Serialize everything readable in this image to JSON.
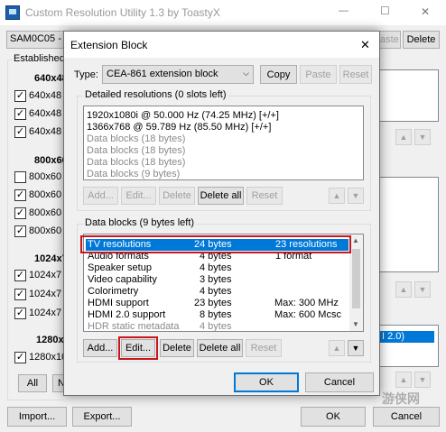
{
  "main_window": {
    "title": "Custom Resolution Utility 1.3 by ToastyX",
    "minimize_glyph": "—",
    "maximize_glyph": "☐",
    "close_glyph": "✕",
    "monitor_select": "SAM0C05 - S",
    "paste_label": "aste",
    "delete_label": "Delete",
    "established_label": "Established",
    "groups": [
      {
        "heading": "640x48",
        "items": [
          {
            "label": "640x48",
            "checked": true
          },
          {
            "label": "640x48",
            "checked": true
          },
          {
            "label": "640x48",
            "checked": true
          }
        ]
      },
      {
        "heading": "800x600",
        "items": [
          {
            "label": "800x60",
            "checked": false
          },
          {
            "label": "800x60",
            "checked": true
          },
          {
            "label": "800x60",
            "checked": true
          },
          {
            "label": "800x60",
            "checked": true
          }
        ]
      },
      {
        "heading": "1024x7",
        "items": [
          {
            "label": "1024x7",
            "checked": true
          },
          {
            "label": "1024x7",
            "checked": true
          },
          {
            "label": "1024x7",
            "checked": true
          }
        ]
      },
      {
        "heading": "1280x1",
        "items": [
          {
            "label": "1280x10",
            "checked": true
          }
        ]
      }
    ],
    "all_label": "All",
    "none_label": "N",
    "import_label": "Import...",
    "export_label": "Export...",
    "ok_label": "OK",
    "cancel_label": "Cancel",
    "right_list_text": "I 2.0)",
    "up_glyph": "▲",
    "down_glyph": "▼"
  },
  "dialog": {
    "title": "Extension Block",
    "close_glyph": "✕",
    "type_label": "Type:",
    "type_value": "CEA-861 extension block",
    "copy_label": "Copy",
    "paste_label": "Paste",
    "reset_label": "Reset",
    "detailed": {
      "title": "Detailed resolutions (0 slots left)",
      "items": [
        {
          "text": "1920x1080i @ 50.000 Hz (74.25 MHz) [+/+]",
          "gray": false
        },
        {
          "text": "1366x768 @ 59.789 Hz (85.50 MHz) [+/+]",
          "gray": false
        },
        {
          "text": "Data blocks (18 bytes)",
          "gray": true
        },
        {
          "text": "Data blocks (18 bytes)",
          "gray": true
        },
        {
          "text": "Data blocks (18 bytes)",
          "gray": true
        },
        {
          "text": "Data blocks (9 bytes)",
          "gray": true
        }
      ],
      "buttons": {
        "add": "Add...",
        "edit": "Edit...",
        "delete": "Delete",
        "delete_all": "Delete all",
        "reset": "Reset"
      }
    },
    "data_blocks": {
      "title": "Data blocks (9 bytes left)",
      "rows": [
        {
          "name": "TV resolutions",
          "bytes": "24 bytes",
          "info": "23 resolutions",
          "selected": true,
          "gray": false
        },
        {
          "name": "Audio formats",
          "bytes": "4 bytes",
          "info": "1 format",
          "selected": false,
          "gray": false
        },
        {
          "name": "Speaker setup",
          "bytes": "4 bytes",
          "info": "",
          "selected": false,
          "gray": false
        },
        {
          "name": "Video capability",
          "bytes": "3 bytes",
          "info": "",
          "selected": false,
          "gray": false
        },
        {
          "name": "Colorimetry",
          "bytes": "4 bytes",
          "info": "",
          "selected": false,
          "gray": false
        },
        {
          "name": "HDMI support",
          "bytes": "23 bytes",
          "info": "Max: 300 MHz",
          "selected": false,
          "gray": false
        },
        {
          "name": "HDMI 2.0 support",
          "bytes": "8 bytes",
          "info": "Max: 600 Mcsc",
          "selected": false,
          "gray": false
        },
        {
          "name": "HDR static metadata",
          "bytes": "4 bytes",
          "info": "",
          "selected": false,
          "gray": true
        }
      ],
      "buttons": {
        "add": "Add...",
        "edit": "Edit...",
        "delete": "Delete",
        "delete_all": "Delete all",
        "reset": "Reset"
      }
    },
    "ok_label": "OK",
    "cancel_label": "Cancel"
  },
  "watermark": "游侠网",
  "colors": {
    "selection": "#0078d7",
    "highlight_box": "#c8161d",
    "default_button": "#0078d7"
  }
}
